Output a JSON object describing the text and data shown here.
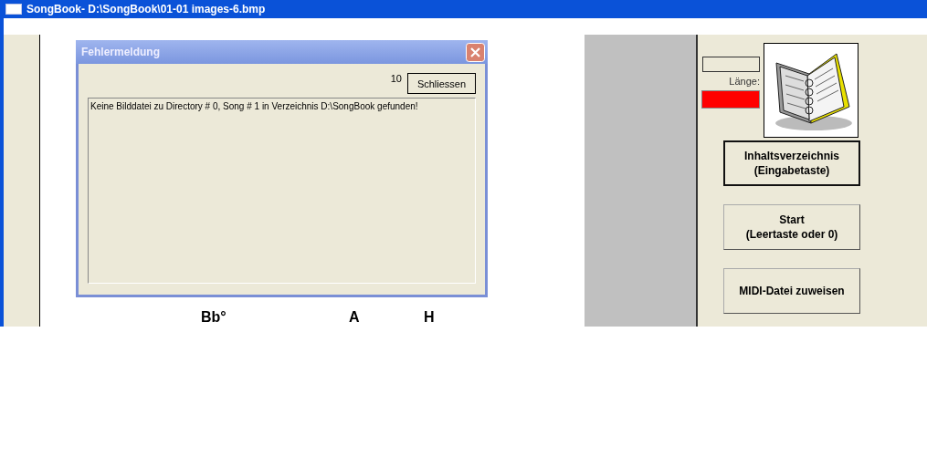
{
  "window": {
    "title": "SongBook- D:\\SongBook\\01-01 images-6.bmp"
  },
  "sheet": {
    "chords": [
      "Bb°",
      "A",
      "H"
    ]
  },
  "side_panel": {
    "length_label": "Länge:",
    "buttons": [
      {
        "label": "Inhaltsverzeichnis\n(Eingabetaste)",
        "default": true
      },
      {
        "label": "Start\n(Leertaste oder 0)",
        "default": false
      },
      {
        "label": "MIDI-Datei zuweisen",
        "default": false
      }
    ]
  },
  "dialog": {
    "title": "Fehlermeldung",
    "countdown": "10",
    "button": "Schliessen",
    "message": "Keine Bilddatei zu Directory # 0, Song # 1 in Verzeichnis D:\\SongBook gefunden!"
  }
}
